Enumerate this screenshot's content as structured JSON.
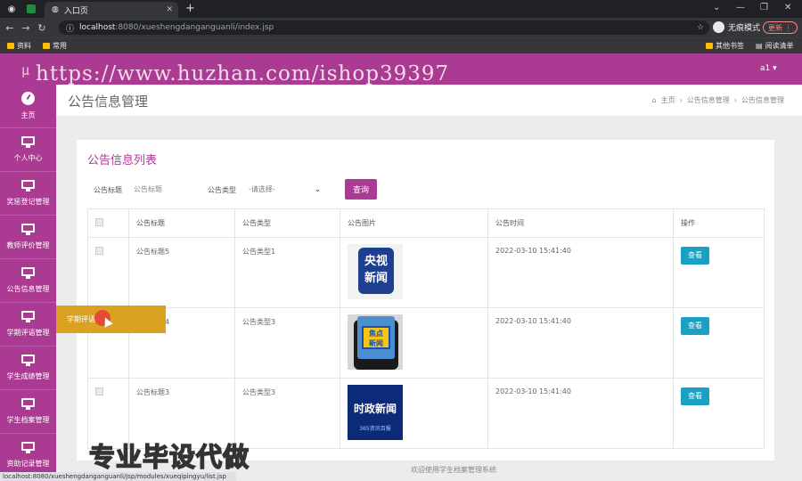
{
  "browser": {
    "tab_title": "入口页",
    "url_host": "localhost",
    "url_path": ":8080/xueshengdanganguanli/index.jsp",
    "incognito_label": "无痕模式",
    "update_label": "更新",
    "bookmarks": [
      "资料",
      "常用"
    ],
    "bookmarks_right": [
      "其他书签",
      "阅读清单"
    ],
    "status_url": "localhost:8080/xueshengdanganguanli/jsp/modules/xueqipingyu/list.jsp"
  },
  "app": {
    "logo": "μ",
    "user": "a1 ▾",
    "watermark_url": "https://www.huzhan.com/ishop39397",
    "watermark_bottom": "专业毕设代做",
    "footer": "欢迎使用学生档案管理系统"
  },
  "sidebar": {
    "items": [
      {
        "label": "主页",
        "icon": "dashboard-icon"
      },
      {
        "label": "个人中心",
        "icon": "monitor-icon"
      },
      {
        "label": "奖惩登记管理",
        "icon": "monitor-icon"
      },
      {
        "label": "教师评价管理",
        "icon": "monitor-icon"
      },
      {
        "label": "公告信息管理",
        "icon": "monitor-icon"
      },
      {
        "label": "学期评语管理",
        "icon": "monitor-icon"
      },
      {
        "label": "学生成绩管理",
        "icon": "monitor-icon"
      },
      {
        "label": "学生档案管理",
        "icon": "monitor-icon"
      },
      {
        "label": "资助记录管理",
        "icon": "monitor-icon"
      }
    ],
    "submenu_label": "学期评语"
  },
  "page": {
    "title": "公告信息管理",
    "breadcrumb": [
      "主页",
      "公告信息管理",
      "公告信息管理"
    ],
    "panel_title": "公告信息列表"
  },
  "filter": {
    "title_label": "公告标题",
    "title_placeholder": "公告标题",
    "type_label": "公告类型",
    "type_selected": "-请选择-",
    "search_button": "查询"
  },
  "table": {
    "headers": [
      "公告标题",
      "公告类型",
      "公告图片",
      "公告时间",
      "操作"
    ],
    "rows": [
      {
        "title": "公告标题5",
        "type": "公告类型1",
        "image_text": [
          "央视",
          "新闻"
        ],
        "time": "2022-03-10 15:41:40",
        "action": "查看"
      },
      {
        "title": "公告标题4",
        "type": "公告类型3",
        "image_text": [
          "焦点",
          "新闻"
        ],
        "time": "2022-03-10 15:41:40",
        "action": "查看"
      },
      {
        "title": "公告标题3",
        "type": "公告类型3",
        "image_text": [
          "时政新闻",
          "365资讯百报"
        ],
        "time": "2022-03-10 15:41:40",
        "action": "查看"
      }
    ]
  }
}
